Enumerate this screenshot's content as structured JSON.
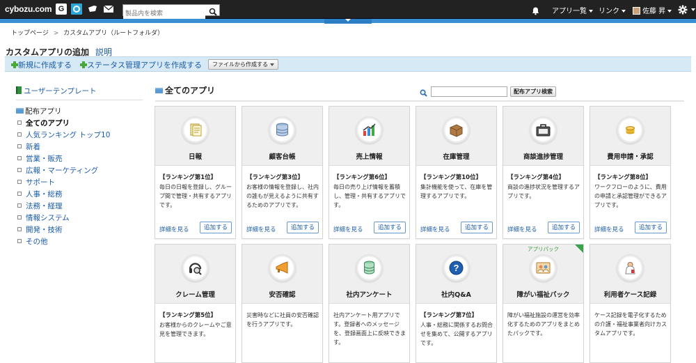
{
  "header": {
    "logo": "cybozu.com",
    "icons": [
      "garoon-g-icon",
      "office-icon",
      "mailwise-icon",
      "mail-icon"
    ],
    "search_placeholder": "製品内を検索",
    "app_list": "アプリ一覧",
    "links": "リンク",
    "user_name": "佐藤 昇"
  },
  "breadcrumb": {
    "top": "トップページ",
    "custom": "カスタムアプリ（ルートフォルダ）"
  },
  "page": {
    "title": "カスタムアプリの追加",
    "help": "説明"
  },
  "actions": {
    "new": "新規に作成する",
    "status": "ステータス管理アプリを作成する",
    "file": "ファイルから作成する"
  },
  "sidebar": {
    "user_template": "ユーザーテンプレート",
    "dist_apps": "配布アプリ",
    "items": [
      "全てのアプリ",
      "人気ランキング トップ10",
      "新着",
      "営業・販売",
      "広報・マーケティング",
      "サポート",
      "人事・総務",
      "法務・経理",
      "情報システム",
      "開発・技術",
      "その他"
    ],
    "selected": "全てのアプリ"
  },
  "main": {
    "title": "全てのアプリ",
    "search_button": "配布アプリ検索",
    "detail_label": "詳細を見る",
    "add_label": "追加する",
    "apps": [
      {
        "name": "日報",
        "icon": "daily-report-icon",
        "rank": "【ランキング第1位】",
        "desc": "毎日の日報を登録し、グループ間で管理・共有するアプリです。"
      },
      {
        "name": "顧客台帳",
        "icon": "customer-db-icon",
        "rank": "【ランキング第3位】",
        "desc": "お客様の情報を登録し、社内の誰もが見えるように共有するためのアプリです。"
      },
      {
        "name": "売上情報",
        "icon": "sales-chart-icon",
        "rank": "【ランキング第6位】",
        "desc": "毎日の売り上げ情報を蓄積し、管理・共有するアプリです。"
      },
      {
        "name": "在庫管理",
        "icon": "inventory-box-icon",
        "rank": "【ランキング第10位】",
        "desc": "集計機能を使って、在庫を管理するアプリです。"
      },
      {
        "name": "商談進捗管理",
        "icon": "briefcase-icon",
        "rank": "【ランキング第4位】",
        "desc": "商談の進捗状況を管理するアプリです。"
      },
      {
        "name": "費用申請・承認",
        "icon": "coins-icon",
        "rank": "【ランキング第8位】",
        "desc": "ワークフローのように、費用の申請と承認管理ができるアプリです。"
      },
      {
        "name": "クレーム管理",
        "icon": "headset-icon",
        "rank": "【ランキング第5位】",
        "desc": "お客様からのクレームやご意見を管理できます。"
      },
      {
        "name": "安否確認",
        "icon": "megaphone-icon",
        "rank": "",
        "desc": "災害時などに社員の安否確認を行うアプリです。"
      },
      {
        "name": "社内アンケート",
        "icon": "survey-db-icon",
        "rank": "",
        "desc": "社内アンケート用アプリです。登録者へのメッセージを、登録画面上に反映できます。"
      },
      {
        "name": "社内Q&A",
        "icon": "question-icon",
        "rank": "【ランキング第7位】",
        "desc": "人事・総務に関係するお問合せを集めて、公開するアプリです。"
      },
      {
        "name": "障がい福祉パック",
        "icon": "welfare-icon",
        "rank": "",
        "ribbon": "アプリパック",
        "desc": "障がい福祉施設の運営を効率化するためのアプリをまとめたパックです。"
      },
      {
        "name": "利用者ケース記録",
        "icon": "caseworker-icon",
        "rank": "",
        "desc": "ケース記録を電子化するための介護・福祉事業者向けカスタムアプリです。"
      }
    ]
  }
}
